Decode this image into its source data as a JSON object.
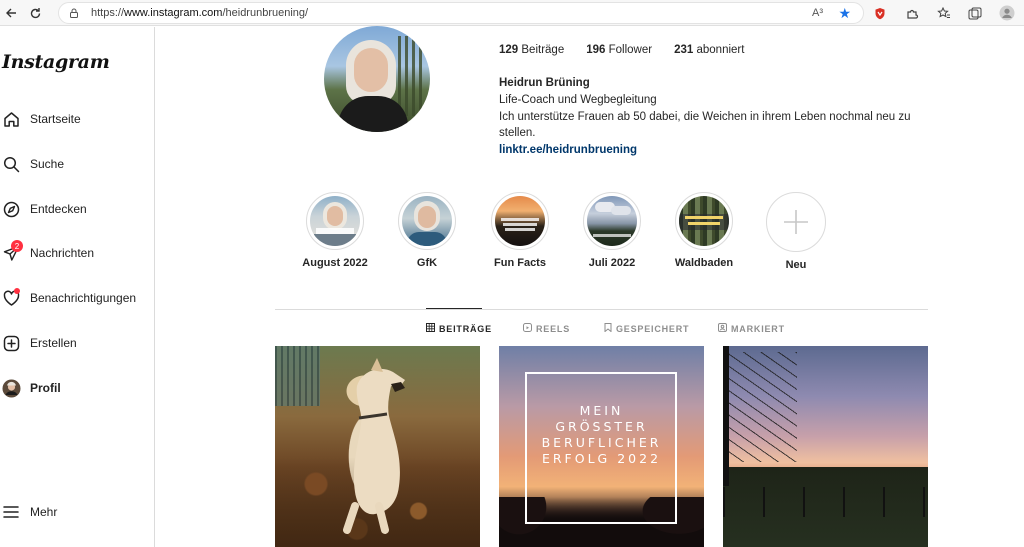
{
  "browser": {
    "url_prefix": "https://",
    "url_host": "www.instagram.com",
    "url_path": "/heidrunbruening/",
    "read_aloud_icon": "A³"
  },
  "sidebar": {
    "logo": "Instagram",
    "items": [
      {
        "label": "Startseite",
        "icon": "home-icon"
      },
      {
        "label": "Suche",
        "icon": "search-icon"
      },
      {
        "label": "Entdecken",
        "icon": "compass-icon"
      },
      {
        "label": "Nachrichten",
        "icon": "messenger-icon",
        "badge": "2"
      },
      {
        "label": "Benachrichtigungen",
        "icon": "heart-icon"
      },
      {
        "label": "Erstellen",
        "icon": "plus-square-icon"
      },
      {
        "label": "Profil",
        "icon": "avatar"
      }
    ],
    "more_label": "Mehr"
  },
  "profile": {
    "stats": {
      "posts_count": "129",
      "posts_label": "Beiträge",
      "followers_count": "196",
      "followers_label": "Follower",
      "following_count": "231",
      "following_label": "abonniert"
    },
    "name": "Heidrun Brüning",
    "bio_line1": "Life-Coach und Wegbegleitung",
    "bio_line2": "Ich unterstütze Frauen ab 50 dabei, die Weichen in ihrem Leben nochmal neu zu stellen.",
    "link": "linktr.ee/heidrunbruening"
  },
  "highlights": [
    {
      "label": "August 2022"
    },
    {
      "label": "GfK"
    },
    {
      "label": "Fun Facts"
    },
    {
      "label": "Juli 2022"
    },
    {
      "label": "Waldbaden"
    },
    {
      "label": "Neu"
    }
  ],
  "tabs": [
    {
      "label": "BEITRÄGE",
      "icon": "grid-icon",
      "active": true
    },
    {
      "label": "REELS",
      "icon": "reels-icon",
      "active": false
    },
    {
      "label": "GESPEICHERT",
      "icon": "bookmark-icon",
      "active": false
    },
    {
      "label": "MARKIERT",
      "icon": "tag-icon",
      "active": false
    }
  ],
  "posts": [
    {
      "alt": ""
    },
    {
      "text_line1": "MEIN",
      "text_line2": "GRÖSSTER",
      "text_line3": "BERUFLICHER",
      "text_line4": "ERFOLG 2022"
    },
    {
      "alt": ""
    }
  ]
}
